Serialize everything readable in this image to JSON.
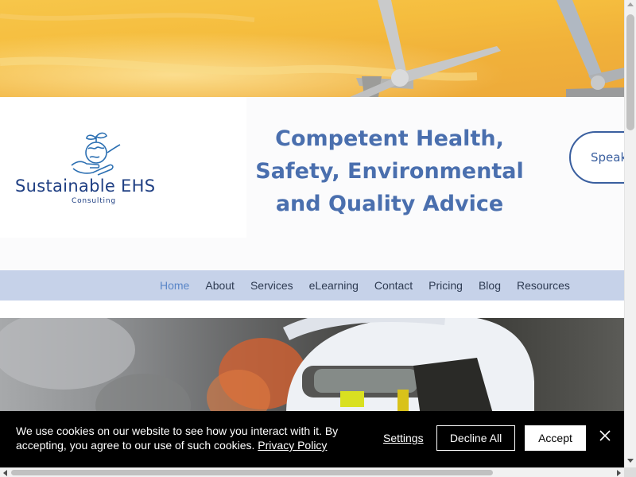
{
  "header": {
    "logo_text": "Sustainable EHS",
    "logo_subtext": "Consulting",
    "headline": "Competent Health, Safety, Environmental and Quality Advice",
    "cta_label": "Speak"
  },
  "nav": {
    "items": [
      {
        "label": "Home",
        "active": true
      },
      {
        "label": "About"
      },
      {
        "label": "Services"
      },
      {
        "label": "eLearning"
      },
      {
        "label": "Contact"
      },
      {
        "label": "Pricing"
      },
      {
        "label": "Blog"
      },
      {
        "label": "Resources"
      }
    ]
  },
  "cookie_banner": {
    "message": "We use cookies on our website to see how you interact with it. By accepting, you agree to our use of such cookies.",
    "policy_link": "Privacy Policy",
    "settings_label": "Settings",
    "decline_label": "Decline All",
    "accept_label": "Accept"
  },
  "colors": {
    "brand_blue": "#1f3f83",
    "headline_blue": "#4a6fae",
    "nav_background": "#c6d2e9",
    "nav_active": "#5a86c8",
    "cookie_background": "#000000"
  },
  "icons": {
    "logo": "globe-in-hand-icon",
    "close": "close-icon"
  }
}
